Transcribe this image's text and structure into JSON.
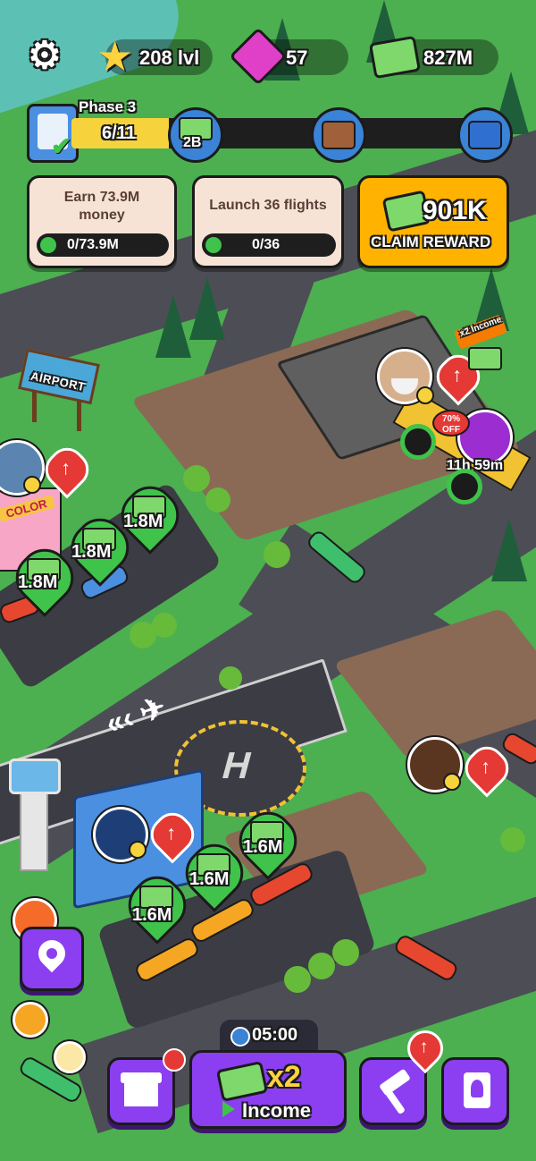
{
  "hud": {
    "level": "208 lvl",
    "gems": "57",
    "money": "827M",
    "icons": [
      "gear-icon",
      "star-icon",
      "gem-icon",
      "cash-icon"
    ]
  },
  "phase": {
    "title": "Phase 3",
    "progress_text": "6/11",
    "progress": 0.545,
    "reward_1": "2B"
  },
  "tasks": [
    {
      "title": "Earn 73.9M money",
      "progress_text": "0/73.9M",
      "progress": 0
    },
    {
      "title": "Launch 36 flights",
      "progress_text": "0/36",
      "progress": 0
    }
  ],
  "claim": {
    "amount": "901K",
    "label": "CLAIM REWARD"
  },
  "map": {
    "airport_sign": "AIRPORT",
    "color_sign": "COLOR",
    "offer_badge": "70% OFF",
    "boost_badge": "x2 Income",
    "timer": "11h 59m",
    "helipad": "H",
    "pins_top": [
      "1.8M",
      "1.8M",
      "1.8M"
    ],
    "pins_bottom": [
      "1.6M",
      "1.6M",
      "1.6M"
    ]
  },
  "bottom": {
    "timer": "05:00",
    "boost_mult": "x2",
    "boost_label": "Income"
  },
  "colors": {
    "grass": "#4caf50",
    "road": "#4d4d55",
    "purple_button": "#8b3ff0",
    "claim_orange": "#ffb300",
    "task_card": "#f7e3d6",
    "progress_green": "#3fc34a"
  }
}
